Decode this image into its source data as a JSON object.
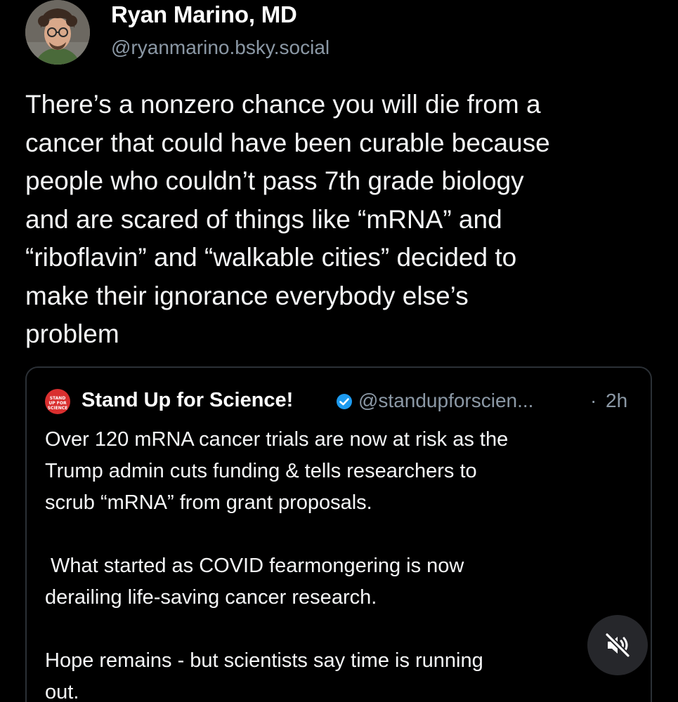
{
  "post": {
    "author_name": "Ryan Marino, MD",
    "author_handle": "@ryanmarino.bsky.social",
    "text_lines": [
      "There’s a nonzero chance you will die from a",
      "cancer that could have been curable because",
      "people who couldn’t pass 7th grade biology",
      "and are scared of things like “mRNA” and",
      "“riboflavin” and “walkable cities” decided to",
      "make their ignorance everybody else’s",
      "problem"
    ]
  },
  "quoted_post": {
    "avatar_text": "STAND UP FOR SCIENCE",
    "author_name": "Stand Up for Science!",
    "author_handle": "@standupforscien...",
    "separator": "·",
    "timestamp": "2h",
    "text_lines": [
      "Over 120 mRNA cancer trials are now at risk as the",
      "Trump admin cuts funding & tells researchers to",
      "scrub “mRNA” from grant proposals.",
      "",
      " What started as COVID fearmongering is now",
      "derailing life-saving cancer research.",
      "",
      "Hope remains - but scientists say time is running",
      "out."
    ]
  },
  "icons": {
    "avatar": "avatar-photo",
    "verified": "verified-badge-icon",
    "mute": "speaker-muted-icon"
  },
  "colors": {
    "background": "#000000",
    "text": "#f5f6f7",
    "secondary_text": "#8b98a5",
    "verified": "#1d9bf0",
    "brand_red": "#d92f2f"
  }
}
